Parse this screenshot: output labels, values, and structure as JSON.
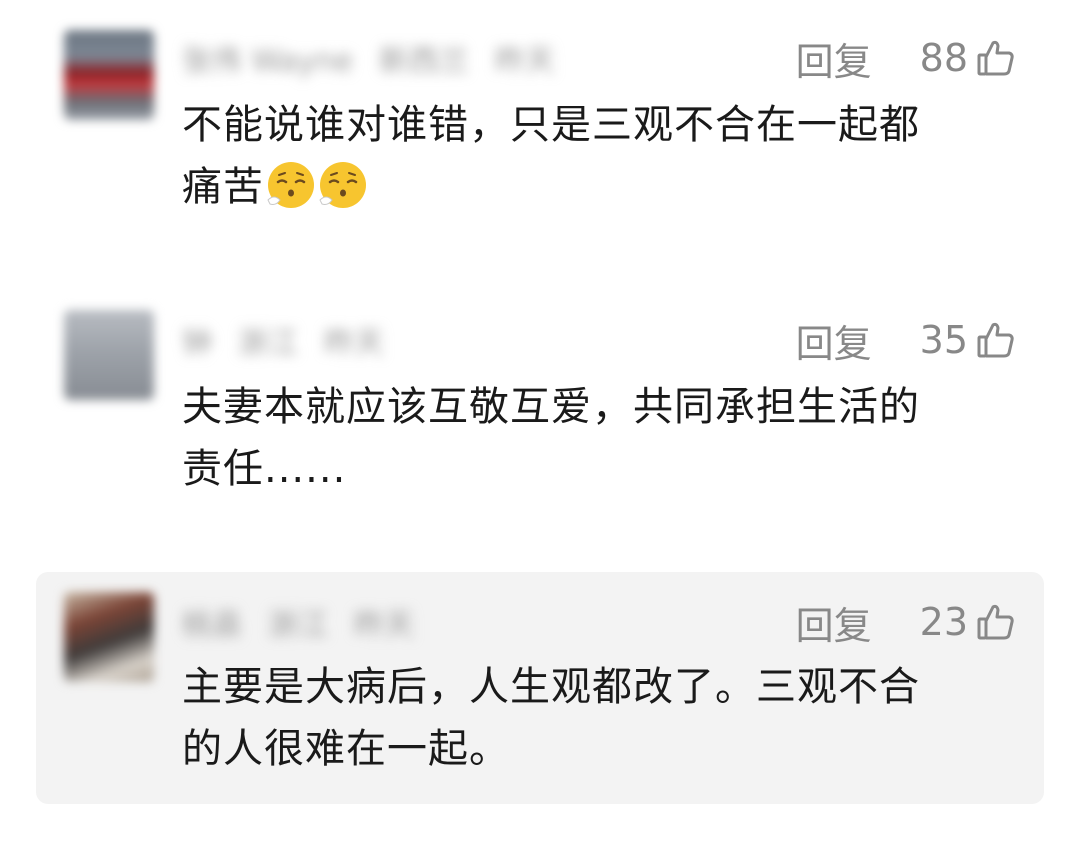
{
  "comments": [
    {
      "username": "张伟 Wayne",
      "location": "新西兰",
      "time": "昨天",
      "reply_label": "回复",
      "likes": "88",
      "text_line1": "不能说谁对谁错，只是三观不合在一起都",
      "text_line2": "痛苦",
      "emojis": [
        "exhale-face-icon",
        "exhale-face-icon"
      ],
      "highlighted": false
    },
    {
      "username": "钟",
      "location": "浙江",
      "time": "昨天",
      "reply_label": "回复",
      "likes": "35",
      "text_line1": "夫妻本就应该互敬互爱，共同承担生活的",
      "text_line2": "责任......",
      "highlighted": false
    },
    {
      "username": "桃县",
      "location": "浙江",
      "time": "昨天",
      "reply_label": "回复",
      "likes": "23",
      "text_line1": "主要是大病后，人生观都改了。三观不合",
      "text_line2": "的人很难在一起。",
      "highlighted": true
    }
  ],
  "colors": {
    "highlight_bg": "#f3f3f3",
    "meta_text": "#888888",
    "body_text": "#1a1a1a",
    "emoji_face": "#f7c52f"
  }
}
